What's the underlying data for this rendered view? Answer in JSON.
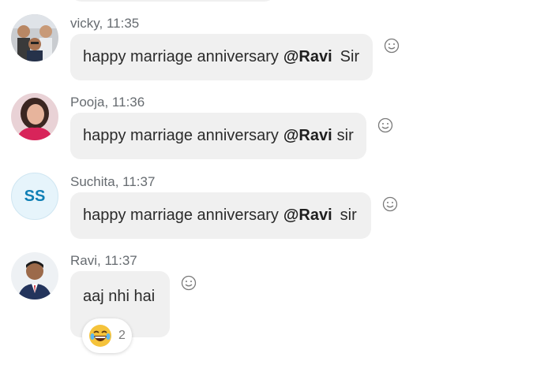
{
  "messages": [
    {
      "sender": "vicky",
      "time": "11:35",
      "meta": "vicky, 11:35",
      "text_before": "happy marriage anniversary",
      "mention": "@Ravi",
      "text_after": "Sir"
    },
    {
      "sender": "Pooja",
      "time": "11:36",
      "meta": "Pooja, 11:36",
      "text_before": "happy marriage anniversary",
      "mention": "@Ravi",
      "text_after": "sir"
    },
    {
      "sender": "Suchita",
      "time": "11:37",
      "meta": "Suchita, 11:37",
      "initials": "SS",
      "text_before": "happy marriage anniversary",
      "mention": "@Ravi",
      "text_after": "sir"
    },
    {
      "sender": "Ravi",
      "time": "11:37",
      "meta": "Ravi, 11:37",
      "text": "aaj nhi hai",
      "reaction": {
        "emoji_icon": "laughing-emoji-icon",
        "count": "2"
      }
    }
  ],
  "icons": {
    "add_reaction": "smiley-outline-icon"
  },
  "colors": {
    "bubble": "#f0f0f0",
    "meta_text": "#666b70",
    "initials_avatar_bg": "#e6f4fb",
    "initials_avatar_text": "#0f7fb5"
  }
}
